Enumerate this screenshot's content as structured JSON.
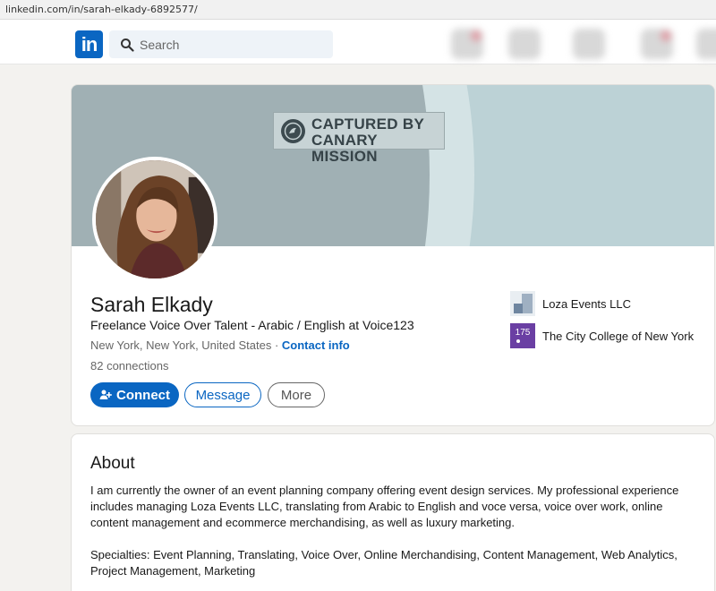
{
  "browser": {
    "url": "linkedin.com/in/sarah-elkady-6892577/"
  },
  "nav": {
    "logo_text": "in",
    "search_placeholder": "Search"
  },
  "banner": {
    "watermark_line1": "CAPTURED BY",
    "watermark_line2": "CANARY MISSION"
  },
  "profile": {
    "name": "Sarah Elkady",
    "headline": "Freelance Voice Over Talent - Arabic / English at Voice123",
    "location": "New York, New York, United States",
    "separator": " · ",
    "contact_info": "Contact info",
    "connections": "82 connections"
  },
  "actions": {
    "connect": "Connect",
    "message": "Message",
    "more": "More"
  },
  "experience": [
    {
      "name": "Loza Events LLC",
      "icon": "company-logo-icon"
    },
    {
      "name": "The City College of New York",
      "icon": "college-logo-icon",
      "logo_text": "175"
    }
  ],
  "about": {
    "title": "About",
    "paragraph1": "I am currently the owner of an event planning company offering event design services. My professional experience includes managing Loza Events LLC, translating from Arabic to English and voce versa, voice over work, online content management and ecommerce merchandising, as well as luxury marketing.",
    "paragraph2": "Specialties: Event Planning, Translating, Voice Over, Online Merchandising, Content Management, Web Analytics, Project Management, Marketing"
  },
  "colors": {
    "brand": "#0a66c2",
    "background": "#f3f2ef",
    "banner": "#bcd2d6"
  }
}
